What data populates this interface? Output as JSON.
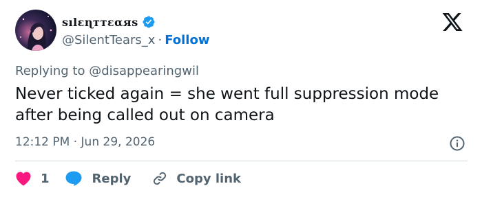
{
  "author": {
    "display_name": "sılɛɳттɛαяs",
    "handle": "@SilentTears_x",
    "separator": "·",
    "follow_label": "Follow",
    "verified_color": "#1d9bf0"
  },
  "tweet": {
    "replying_prefix": "Replying to ",
    "replying_to": "@disappearingwil",
    "text": "Never ticked again = she went full suppression mode after being called out on camera",
    "time": "12:12 PM",
    "date_separator": "·",
    "date": "Jun 29, 2026"
  },
  "actions": {
    "like_count": "1",
    "reply_label": "Reply",
    "copy_label": "Copy link"
  },
  "icons": {
    "brand": "x-logo-icon",
    "info": "info-icon",
    "like": "heart-icon",
    "reply": "speech-bubble-icon",
    "copy": "link-icon"
  },
  "colors": {
    "like": "#f91880",
    "reply": "#1d9bf0",
    "follow": "#006fd6",
    "muted": "#536471"
  }
}
